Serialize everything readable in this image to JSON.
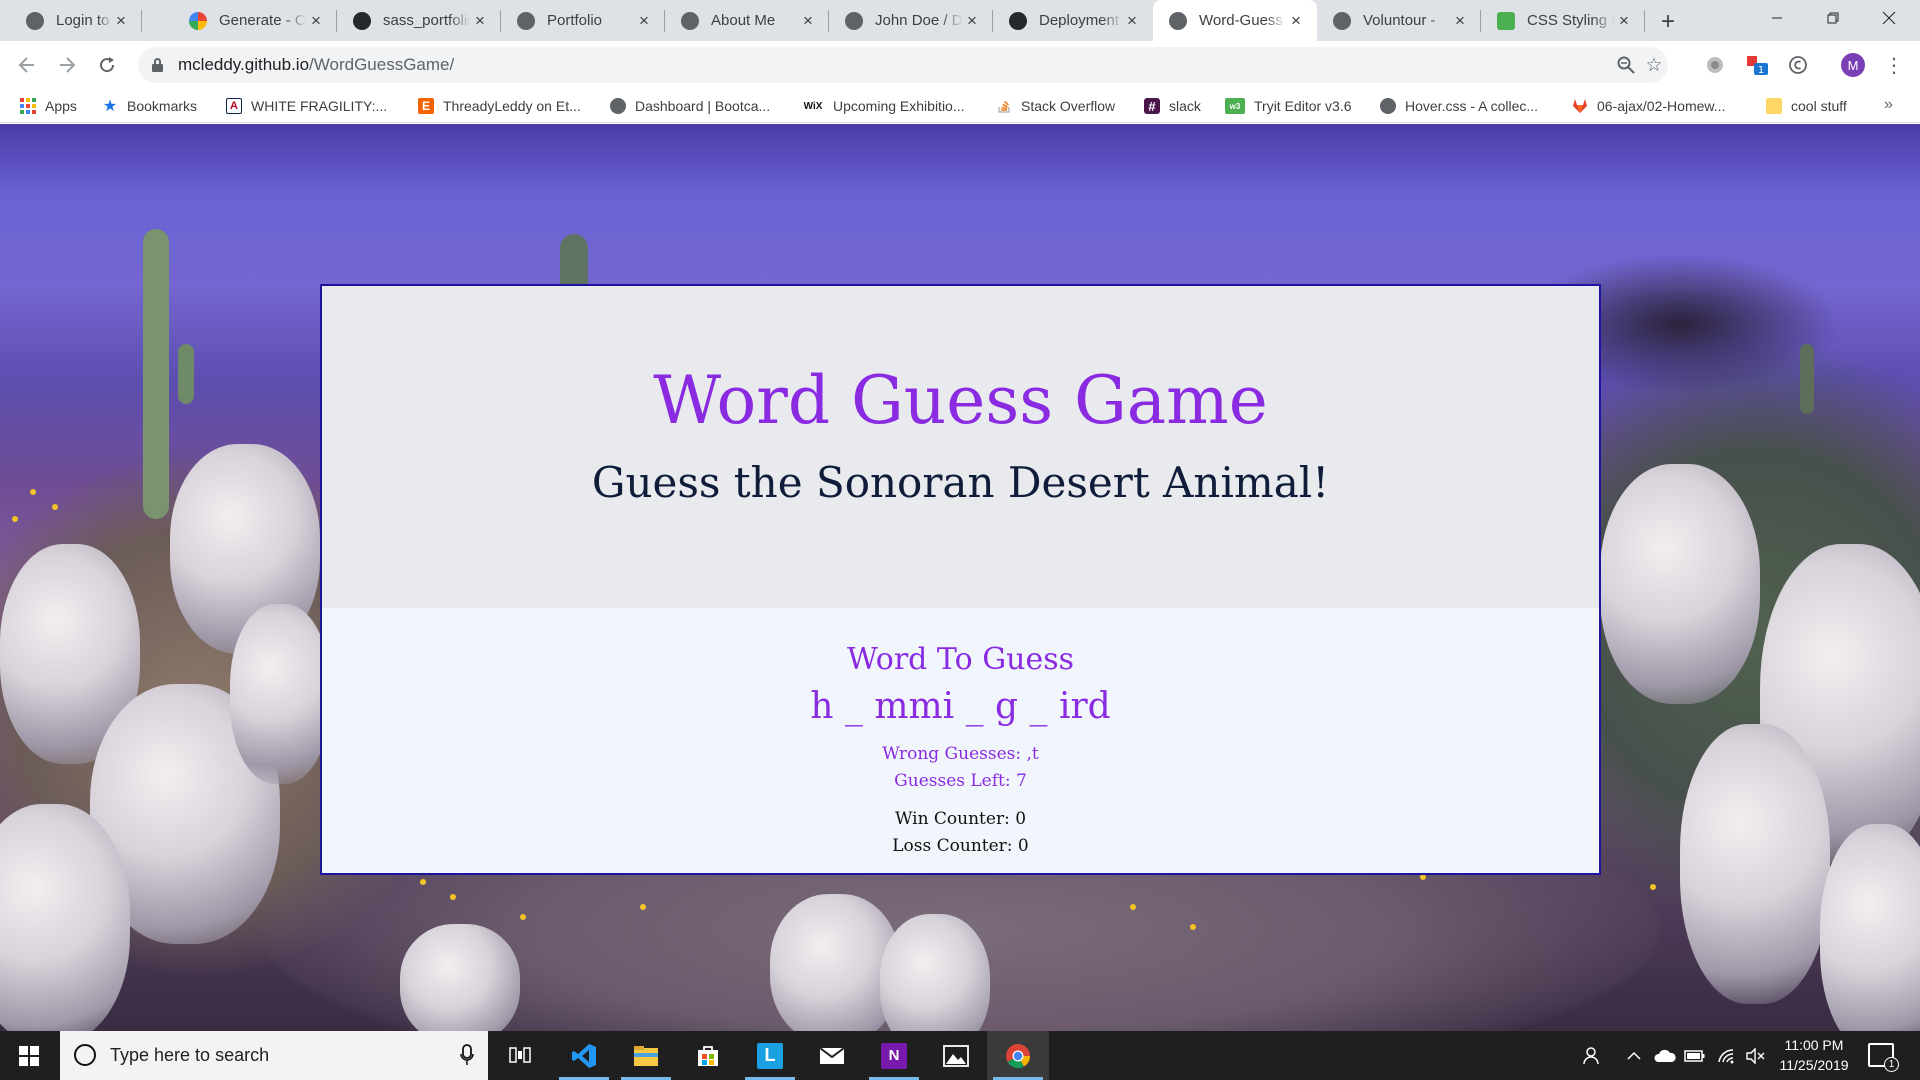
{
  "browser": {
    "tabs": [
      {
        "title": "Login to Your Account",
        "favicon": "globe-icon",
        "active": false
      },
      {
        "title": "Generate - C",
        "favicon": "google-icon",
        "active": false
      },
      {
        "title": "sass_portfolio",
        "favicon": "github-icon",
        "active": false
      },
      {
        "title": "Portfolio",
        "favicon": "globe-icon",
        "active": false
      },
      {
        "title": "About Me",
        "favicon": "globe-icon",
        "active": false
      },
      {
        "title": "John Doe / D",
        "favicon": "globe-icon",
        "active": false
      },
      {
        "title": "Deployment",
        "favicon": "github-icon",
        "active": false
      },
      {
        "title": "Word-Guess",
        "favicon": "globe-icon",
        "active": true
      },
      {
        "title": "Voluntour - ",
        "favicon": "globe-icon",
        "active": false
      },
      {
        "title": "CSS Styling I",
        "favicon": "tryit-icon",
        "active": false
      }
    ],
    "address": {
      "host": "mcleddy.github.io",
      "path": "/WordGuessGame/"
    },
    "profile_initial": "M",
    "extension_badge": "1",
    "bookmarks": [
      {
        "label": "Apps",
        "icon": "apps-grid-icon"
      },
      {
        "label": "Bookmarks",
        "icon": "star-icon"
      },
      {
        "label": "WHITE FRAGILITY:...",
        "icon": "university-logo-icon"
      },
      {
        "label": "ThreadyLeddy on Et...",
        "icon": "etsy-icon"
      },
      {
        "label": "Dashboard | Bootca...",
        "icon": "globe-icon"
      },
      {
        "label": "Upcoming Exhibitio...",
        "icon": "wix-icon"
      },
      {
        "label": "Stack Overflow",
        "icon": "stackoverflow-icon"
      },
      {
        "label": "slack",
        "icon": "slack-icon"
      },
      {
        "label": "Tryit Editor v3.6",
        "icon": "tryit-icon"
      },
      {
        "label": "Hover.css - A collec...",
        "icon": "globe-icon"
      },
      {
        "label": "06-ajax/02-Homew...",
        "icon": "gitlab-icon"
      },
      {
        "label": "cool stuff",
        "icon": "folder-icon"
      }
    ]
  },
  "game": {
    "title": "Word Guess Game",
    "subtitle": "Guess the Sonoran Desert Animal!",
    "word_heading": "Word To Guess",
    "current_word": "h _ mmi _ g _ ird",
    "wrong_guesses": "Wrong Guesses: ,t",
    "guesses_left": "Guesses Left: 7",
    "win_counter": "Win Counter: 0",
    "loss_counter": "Loss Counter: 0"
  },
  "taskbar": {
    "search_placeholder": "Type here to search",
    "time": "11:00 PM",
    "date": "11/25/2019",
    "notification_count": "1",
    "apps": [
      "task-view-icon",
      "vscode-icon",
      "file-explorer-icon",
      "store-icon",
      "app-l-icon",
      "mail-icon",
      "onenote-icon",
      "photos-icon",
      "chrome-icon"
    ]
  },
  "colors": {
    "title_purple": "#8a2be2",
    "card_border": "#1d15a0",
    "jumbotron_bg": "#e8eaed",
    "card_bg": "#f0f6fc"
  }
}
